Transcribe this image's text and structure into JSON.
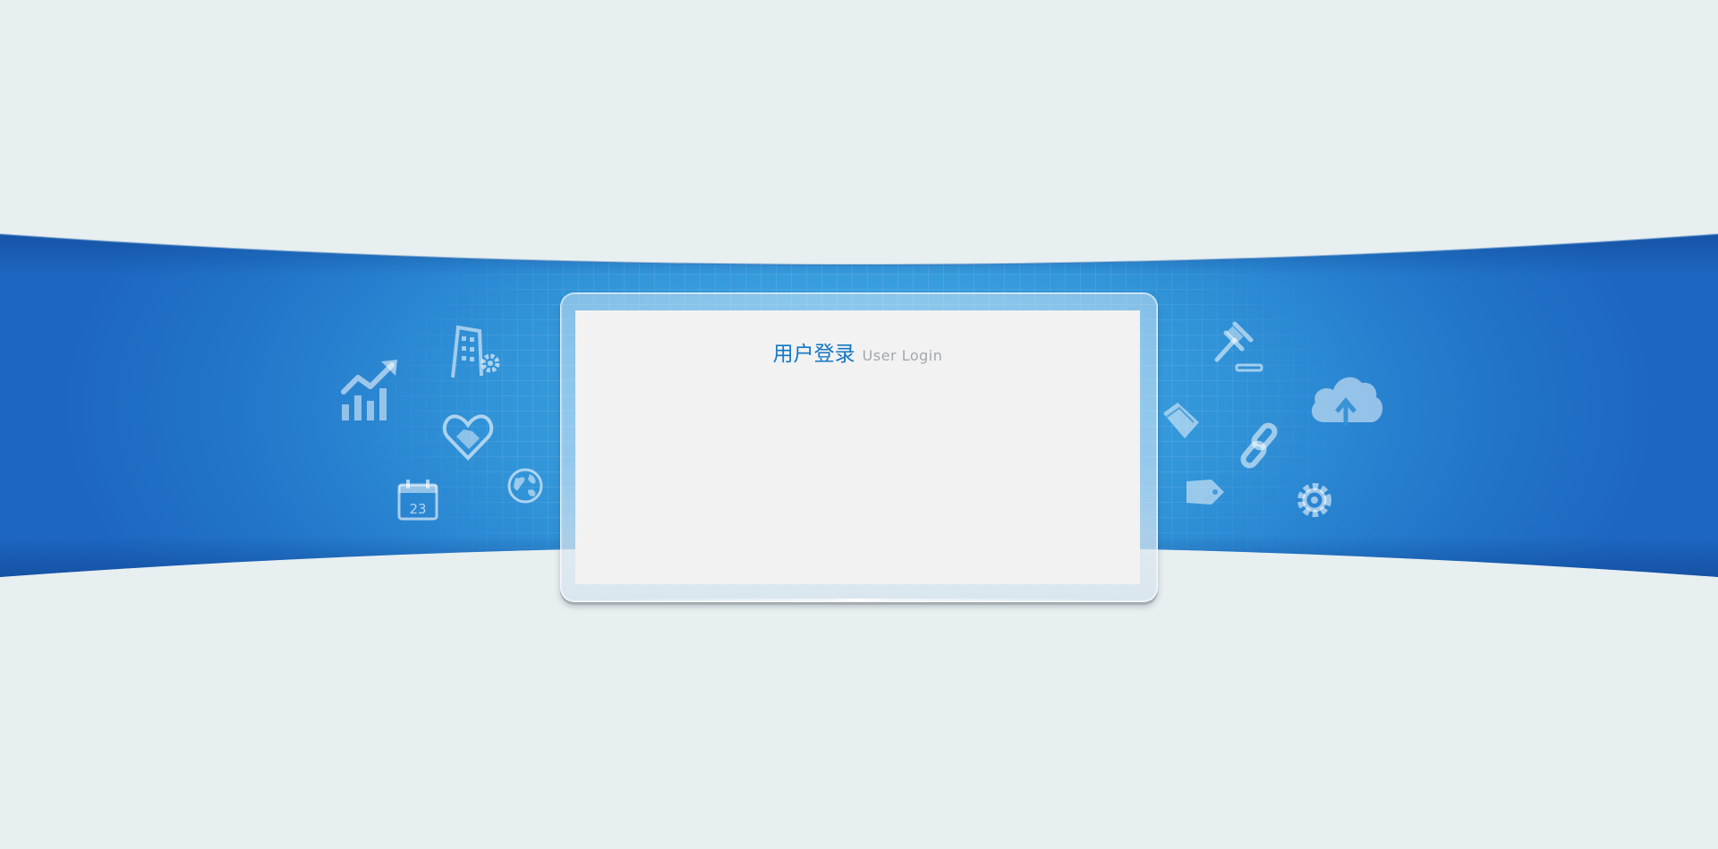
{
  "login": {
    "title_cn": "用户登录",
    "title_en": "User Login"
  },
  "banner": {
    "calendar_day": "23"
  },
  "colors": {
    "page_background": "#e7eff1",
    "banner_blue": "#1f6fc6",
    "banner_light": "#3aa3e0",
    "title_blue": "#1277c4",
    "subtitle_gray": "#a3a8ad",
    "panel_background": "#f2f2f2"
  },
  "icons": [
    "growth-chart-icon",
    "office-building-icon",
    "handshake-heart-icon",
    "calendar-icon",
    "globe-icon",
    "gavel-icon",
    "cloud-upload-icon",
    "folder-icon",
    "link-icon",
    "price-tag-icon",
    "gear-icon"
  ]
}
